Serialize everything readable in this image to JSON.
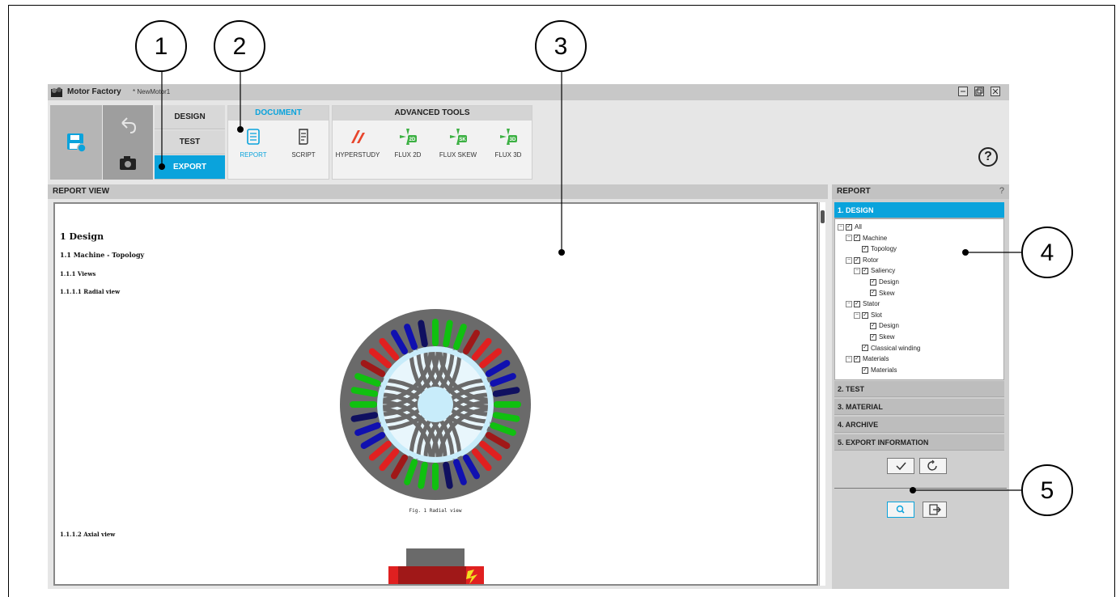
{
  "window": {
    "app_name": "Motor Factory",
    "doc_name": "* NewMotor1"
  },
  "ribbon": {
    "modes": [
      {
        "label": "DESIGN",
        "active": false
      },
      {
        "label": "TEST",
        "active": false
      },
      {
        "label": "EXPORT",
        "active": true
      }
    ],
    "document_group": {
      "title": "DOCUMENT",
      "tools": [
        {
          "label": "REPORT",
          "icon": "report-icon",
          "active": true
        },
        {
          "label": "SCRIPT",
          "icon": "script-icon",
          "active": false
        }
      ]
    },
    "advanced_group": {
      "title": "ADVANCED TOOLS",
      "tools": [
        {
          "label": "HYPERSTUDY",
          "icon": "hyperstudy-icon"
        },
        {
          "label": "FLUX 2D",
          "icon": "flux-2d-icon",
          "badge": "2D"
        },
        {
          "label": "FLUX SKEW",
          "icon": "flux-skew-icon",
          "badge": "SK"
        },
        {
          "label": "FLUX 3D",
          "icon": "flux-3d-icon",
          "badge": "3D"
        }
      ]
    },
    "help_label": "?"
  },
  "report_view": {
    "title": "REPORT VIEW",
    "h1": "1 Design",
    "h2": "1.1 Machine - Topology",
    "h3": "1.1.1 Views",
    "h4a": "1.1.1.1 Radial view",
    "fig_caption": "Fig. 1 Radial view",
    "h4b": "1.1.1.2 Axial view"
  },
  "report_panel": {
    "title": "REPORT",
    "help": "?",
    "sections": [
      {
        "label": "1. DESIGN",
        "active": true
      },
      {
        "label": "2. TEST",
        "active": false
      },
      {
        "label": "3. MATERIAL",
        "active": false
      },
      {
        "label": "4. ARCHIVE",
        "active": false
      },
      {
        "label": "5. EXPORT INFORMATION",
        "active": false
      }
    ],
    "tree": [
      {
        "label": "All",
        "level": 0,
        "expander": true
      },
      {
        "label": "Machine",
        "level": 1,
        "expander": true
      },
      {
        "label": "Topology",
        "level": 2,
        "expander": false
      },
      {
        "label": "Rotor",
        "level": 1,
        "expander": true
      },
      {
        "label": "Saliency",
        "level": 2,
        "expander": true
      },
      {
        "label": "Design",
        "level": 3,
        "expander": false
      },
      {
        "label": "Skew",
        "level": 3,
        "expander": false
      },
      {
        "label": "Stator",
        "level": 1,
        "expander": true
      },
      {
        "label": "Slot",
        "level": 2,
        "expander": true
      },
      {
        "label": "Design",
        "level": 3,
        "expander": false
      },
      {
        "label": "Skew",
        "level": 3,
        "expander": false
      },
      {
        "label": "Classical winding",
        "level": 2,
        "expander": false
      },
      {
        "label": "Materials",
        "level": 1,
        "expander": true
      },
      {
        "label": "Materials",
        "level": 2,
        "expander": false
      }
    ]
  },
  "callouts": [
    "1",
    "2",
    "3",
    "4",
    "5"
  ],
  "colors": {
    "accent": "#0aa3dc",
    "flux_green": "#3cb043",
    "hyperstudy_red": "#e8452c",
    "phase_red": "#e02020",
    "phase_green": "#10c010",
    "phase_blue": "#1010b0",
    "phase_darkred": "#a01818",
    "phase_darkblue": "#101060",
    "bore": "#c8ecfa",
    "stator": "#6a6a6a"
  }
}
